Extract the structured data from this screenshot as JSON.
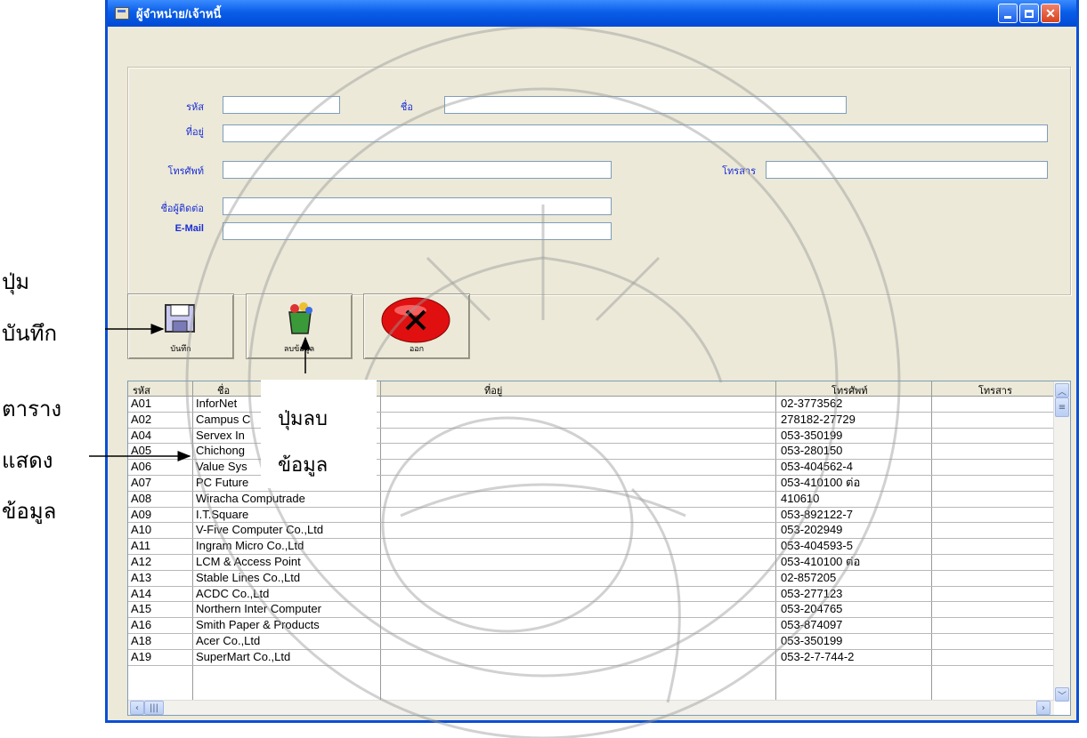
{
  "window": {
    "title": "ผู้จำหน่าย/เจ้าหนี้",
    "minimize_icon": "minimize-icon",
    "maximize_icon": "maximize-icon",
    "close_icon": "close-icon"
  },
  "form": {
    "code_label": "รหัส",
    "code_value": "",
    "name_label": "ชื่อ",
    "name_value": "",
    "address_label": "ที่อยู่",
    "address_value": "",
    "phone_label": "โทรศัพท์",
    "phone_value": "",
    "fax_label": "โทรสาร",
    "fax_value": "",
    "contact_label": "ชื่อผู้ติดต่อ",
    "contact_value": "",
    "email_label": "E-Mail",
    "email_value": ""
  },
  "buttons": {
    "save_label": "บันทึก",
    "delete_label": "ลบข้อมูล",
    "exit_label": "ออก"
  },
  "grid": {
    "columns": [
      "รหัส",
      "ชื่อ",
      "ที่อยู่",
      "โทรศัพท์",
      "โทรสาร"
    ],
    "rows": [
      [
        "A01",
        "InforNet",
        "",
        "02-3773562",
        ""
      ],
      [
        "A02",
        "Campus C",
        "",
        "278182-27729",
        ""
      ],
      [
        "A04",
        "Servex In",
        "",
        "053-350199",
        ""
      ],
      [
        "A05",
        "Chichong",
        "",
        "053-280150",
        ""
      ],
      [
        "A06",
        "Value Sys",
        "",
        "053-404562-4",
        ""
      ],
      [
        "A07",
        "PC Future",
        "",
        "053-410100 ต่อ",
        ""
      ],
      [
        "A08",
        "Wiracha Computrade",
        "",
        "410610",
        ""
      ],
      [
        "A09",
        "I.T.Square",
        "",
        "053-892122-7",
        ""
      ],
      [
        "A10",
        "V-Five Computer Co.,Ltd",
        "",
        "053-202949",
        ""
      ],
      [
        "A11",
        "Ingram Micro Co.,Ltd",
        "",
        "053-404593-5",
        ""
      ],
      [
        "A12",
        "LCM & Access Point",
        "",
        "053-410100 ต่อ",
        ""
      ],
      [
        "A13",
        "Stable Lines Co.,Ltd",
        "",
        "02-857205",
        ""
      ],
      [
        "A14",
        "ACDC Co.,Ltd",
        "",
        "053-277123",
        ""
      ],
      [
        "A15",
        "Northern Inter Computer",
        "",
        "053-204765",
        ""
      ],
      [
        "A16",
        "Smith Paper & Products",
        "",
        "053-874097",
        ""
      ],
      [
        "A18",
        "Acer Co.,Ltd",
        "",
        "053-350199",
        ""
      ],
      [
        "A19",
        "SuperMart Co.,Ltd",
        "",
        "053-2-7-744-2",
        ""
      ]
    ]
  },
  "annotations": {
    "save_line1": "ปุ่ม",
    "save_line2": "บันทึก",
    "table_line1": "ตาราง",
    "table_line2": "แสดง",
    "table_line3": "ข้อมูล",
    "delete_line1": "ปุ่มลบ",
    "delete_line2": "ข้อมูล"
  }
}
